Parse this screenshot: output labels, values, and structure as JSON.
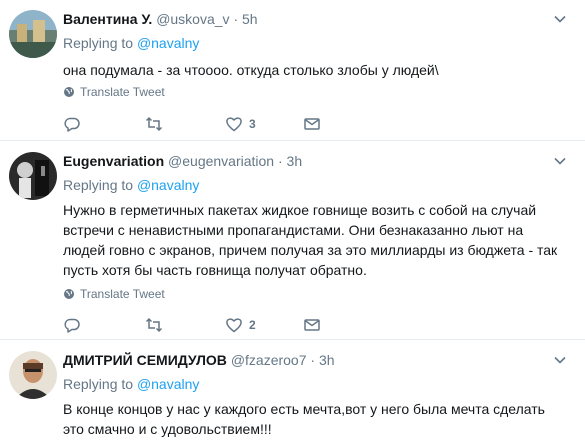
{
  "replying_label": "Replying to",
  "translate_label": "Translate Tweet",
  "tweets": [
    {
      "name": "Валентина У.",
      "handle": "@uskova_v",
      "dot": "·",
      "time": "5h",
      "mention": "@navalny",
      "text": "она подумала - за чтоооо. откуда столько злобы у людей\\",
      "likes": "3"
    },
    {
      "name": "Eugenvariation",
      "handle": "@eugenvariation",
      "dot": "·",
      "time": "3h",
      "mention": "@navalny",
      "text": "Нужно в герметичных пакетах жидкое говнище возить с собой на случай встречи с ненавистными пропагандистами. Они безнаказанно льют на людей говно с экранов, причем получая за это миллиарды из бюджета - так пусть хотя бы часть говнища получат обратно.",
      "likes": "2"
    },
    {
      "name": "ДМИТРИЙ СЕМИДУЛОВ",
      "handle": "@fzazeroo7",
      "dot": "·",
      "time": "3h",
      "mention": "@navalny",
      "text": "В конце концов у нас у каждого есть мечта,вот у него была мечта сделать это смачно и с удовольствием!!!"
    }
  ]
}
